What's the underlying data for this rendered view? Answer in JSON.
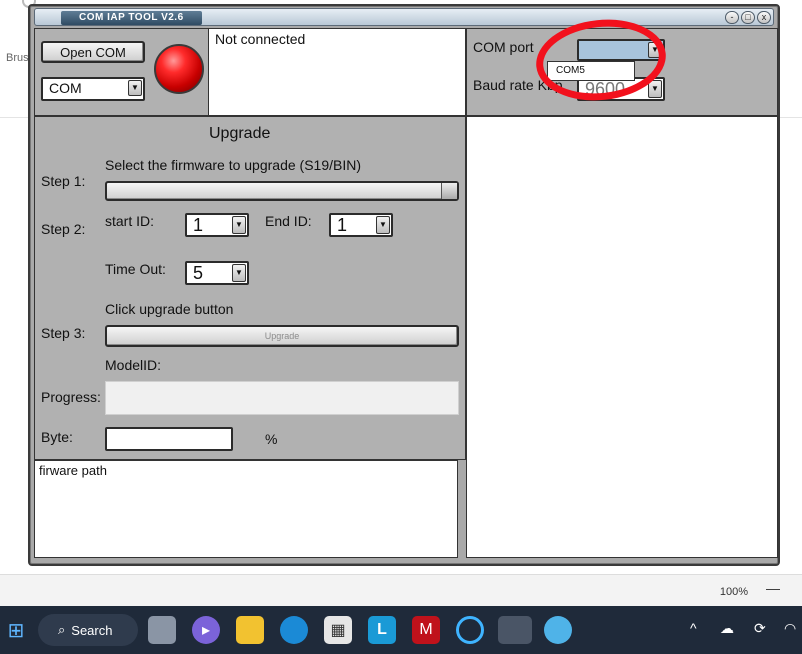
{
  "background": {
    "left_label": "Brus",
    "zoom": "100%",
    "minus": "—"
  },
  "window": {
    "title": "COM IAP  TOOL V2.6",
    "buttons": {
      "minimize": "-",
      "maximize": "□",
      "close": "x"
    }
  },
  "connection": {
    "open_button": "Open COM",
    "port_select": "COM",
    "status_text": "Not connected"
  },
  "settings": {
    "com_port_label": "COM port",
    "com_port_value": "",
    "com_port_option": "COM5",
    "baud_label": "Baud rate Kbp",
    "baud_value": "9600"
  },
  "upgrade": {
    "title": "Upgrade",
    "step1_label": "Step 1:",
    "step1_instruction": "Select the firmware  to upgrade (S19/BIN)",
    "step2_label": "Step 2:",
    "start_id_label": "start ID:",
    "start_id_value": "1",
    "end_id_label": "End ID:",
    "end_id_value": "1",
    "timeout_label": "Time Out:",
    "timeout_value": "5",
    "step3_instruction": "Click upgrade button",
    "step3_label": "Step 3:",
    "upgrade_button": "Upgrade",
    "model_id_label": "ModelID:",
    "progress_label": "Progress:",
    "progress_value": 0,
    "byte_label": "Byte:",
    "percent_sign": "%"
  },
  "log": {
    "firmware_path_text": "firware path"
  },
  "taskbar": {
    "search_label": "Search",
    "icons": [
      "windows-start-icon",
      "search-icon",
      "task-view-icon",
      "meet-icon",
      "file-explorer-icon",
      "edge-icon",
      "store-icon",
      "l-app-icon",
      "mcafee-icon",
      "cortana-icon",
      "iap-tool-icon",
      "paint-icon"
    ],
    "tray_icons": [
      "chevron-up-icon",
      "cloud-icon",
      "sync-icon",
      "wifi-icon"
    ]
  },
  "colors": {
    "window_bg": "#a9a9a9",
    "led": "#e00000",
    "annotation": "#f2111d",
    "taskbar": "#1f2a3a"
  }
}
